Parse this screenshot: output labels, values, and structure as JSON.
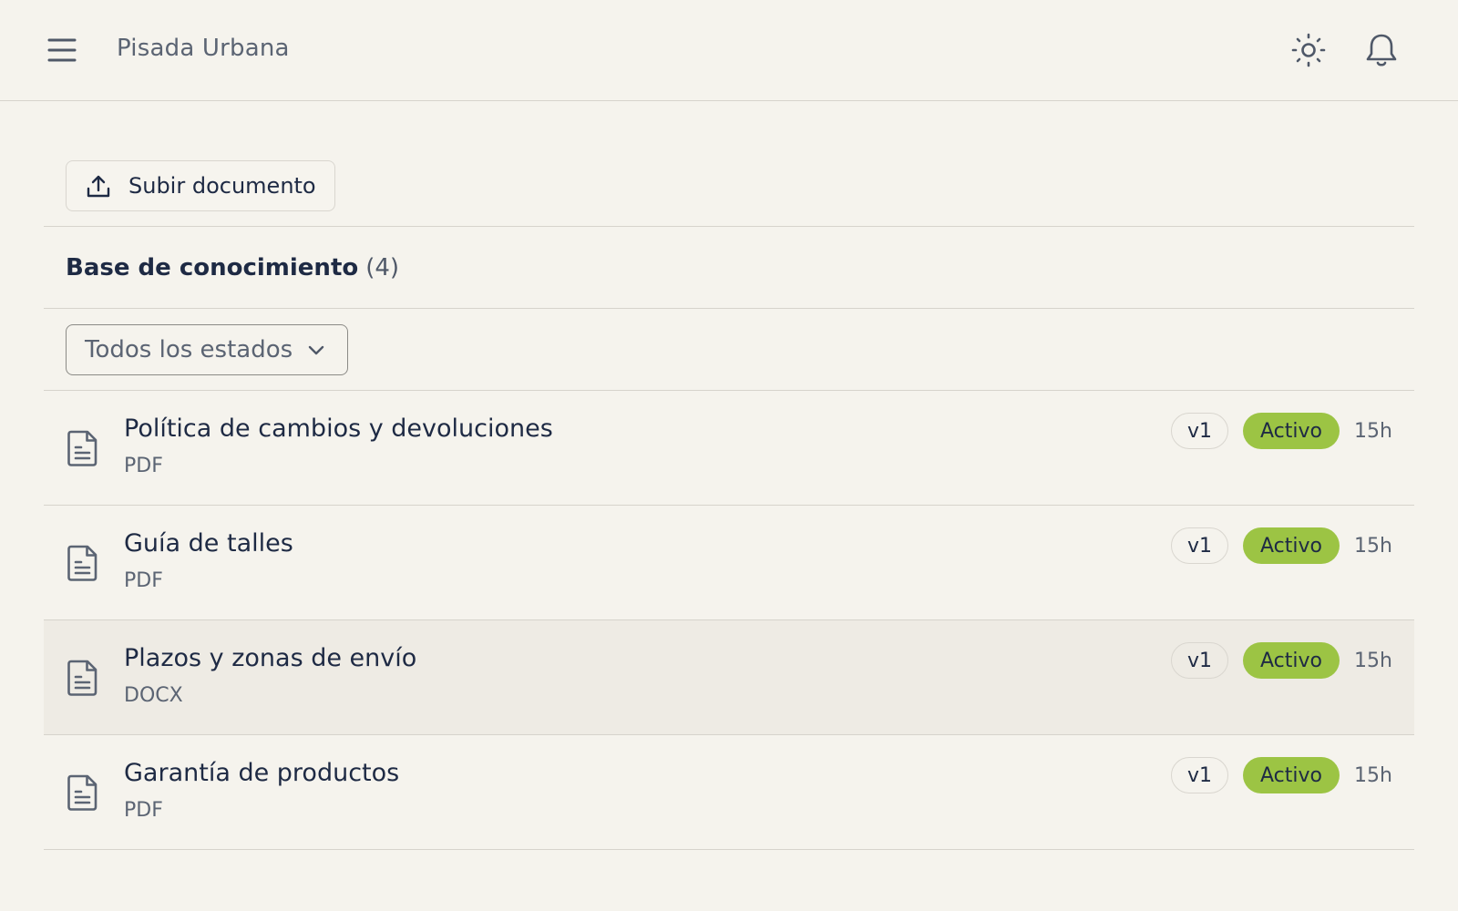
{
  "header": {
    "app_name": "Pisada Urbana",
    "menu_icon": "hamburger-icon",
    "theme_icon": "sun-icon",
    "notification_icon": "bell-icon"
  },
  "toolbar": {
    "upload_label": "Subir documento",
    "upload_icon": "upload-icon"
  },
  "section": {
    "title": "Base de conocimiento",
    "count": "(4)"
  },
  "filter": {
    "selected": "Todos los estados"
  },
  "colors": {
    "background": "#f5f3ed",
    "status_active": "#9cc444",
    "text_primary": "#1e2a44",
    "text_muted": "#5b6473"
  },
  "documents": [
    {
      "name": "Política de cambios y devoluciones",
      "type": "PDF",
      "version": "v1",
      "status": "Activo",
      "age": "15h"
    },
    {
      "name": "Guía de talles",
      "type": "PDF",
      "version": "v1",
      "status": "Activo",
      "age": "15h"
    },
    {
      "name": "Plazos y zonas de envío",
      "type": "DOCX",
      "version": "v1",
      "status": "Activo",
      "age": "15h"
    },
    {
      "name": "Garantía de productos",
      "type": "PDF",
      "version": "v1",
      "status": "Activo",
      "age": "15h"
    }
  ]
}
